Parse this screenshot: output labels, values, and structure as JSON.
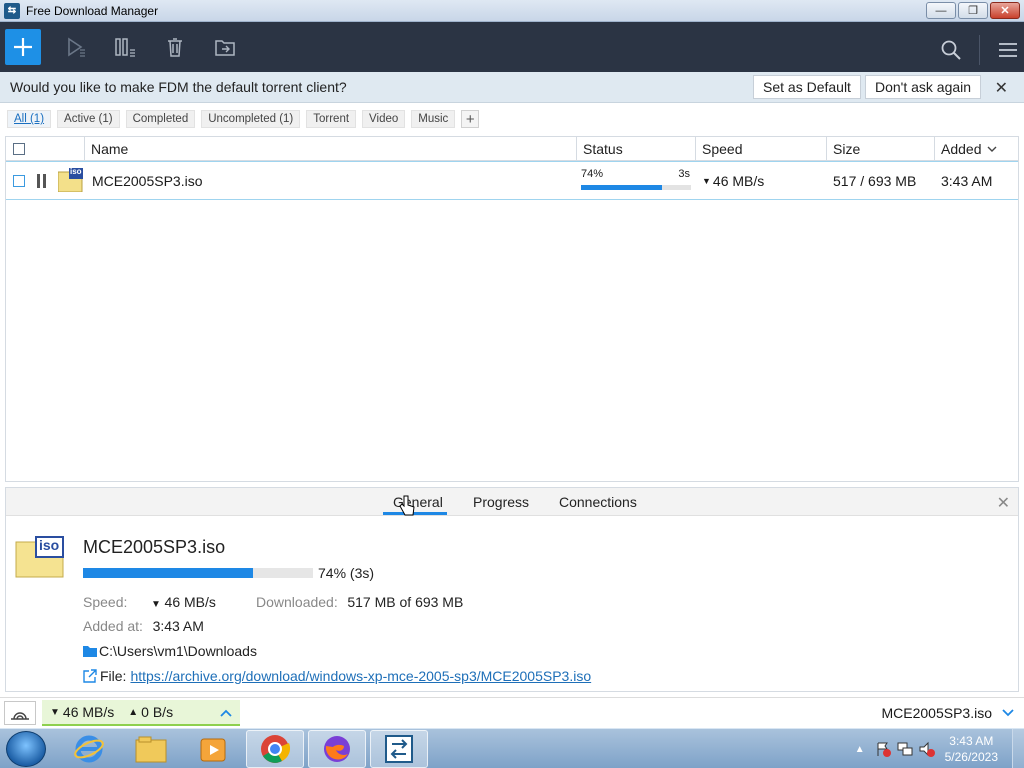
{
  "window": {
    "title": "Free Download Manager"
  },
  "toolbar": {
    "add_icon": "plus-icon",
    "colors": {
      "background": "#2b3444",
      "accent": "#1e90e6"
    }
  },
  "notification": {
    "message": "Would you like to make FDM the default torrent client?",
    "set_default": "Set as Default",
    "dont_ask": "Don't ask again",
    "close": "✕"
  },
  "filters": [
    {
      "label": "All (1)",
      "active": true
    },
    {
      "label": "Active (1)"
    },
    {
      "label": "Completed"
    },
    {
      "label": "Uncompleted (1)"
    },
    {
      "label": "Torrent"
    },
    {
      "label": "Video"
    },
    {
      "label": "Music"
    }
  ],
  "filter_add": "+",
  "table": {
    "headers": {
      "name": "Name",
      "status": "Status",
      "speed": "Speed",
      "size": "Size",
      "added": "Added"
    },
    "rows": [
      {
        "name": "MCE2005SP3.iso",
        "progress_text": "74%",
        "progress": 0.74,
        "eta": "3s",
        "speed": "46 MB/s",
        "size": "517 / 693 MB",
        "added": "3:43 AM",
        "file_badge": "iso"
      }
    ]
  },
  "details": {
    "tabs": [
      "General",
      "Progress",
      "Connections"
    ],
    "active_tab": "General",
    "file_name": "MCE2005SP3.iso",
    "file_badge": "iso",
    "progress": 0.74,
    "progress_text": "74%",
    "eta_text": "(3s)",
    "speed_label": "Speed:",
    "speed_value": "46 MB/s",
    "downloaded_label": "Downloaded:",
    "downloaded_value": "517 MB of 693 MB",
    "added_label": "Added at:",
    "added_value": "3:43 AM",
    "folder": "C:\\Users\\vm1\\Downloads",
    "file_label": "File:",
    "file_url": "https://archive.org/download/windows-xp-mce-2005-sp3/MCE2005SP3.iso"
  },
  "statusbar": {
    "down_speed": "46 MB/s",
    "up_speed": "0 B/s",
    "current_file": "MCE2005SP3.iso"
  },
  "taskbar": {
    "time": "3:43 AM",
    "date": "5/26/2023"
  }
}
